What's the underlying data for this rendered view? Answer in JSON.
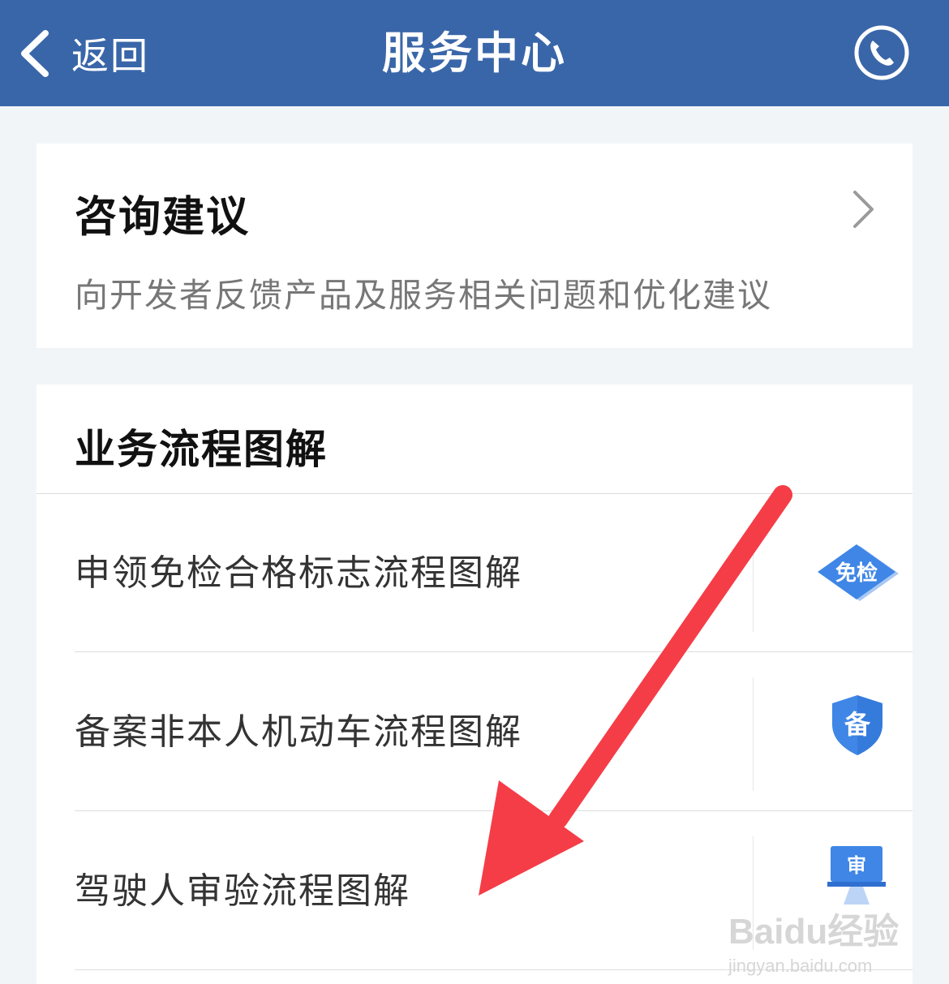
{
  "header": {
    "back_label": "返回",
    "title": "服务中心",
    "back_icon": "chevron-left-icon",
    "phone_icon": "phone-icon"
  },
  "consult": {
    "title": "咨询建议",
    "subtitle": "向开发者反馈产品及服务相关问题和优化建议",
    "chevron_icon": "chevron-right-icon"
  },
  "process": {
    "title": "业务流程图解",
    "items": [
      {
        "label": "申领免检合格标志流程图解",
        "icon_text": "免检",
        "icon": "exemption-diamond-icon"
      },
      {
        "label": "备案非本人机动车流程图解",
        "icon_text": "备",
        "icon": "record-shield-icon"
      },
      {
        "label": "驾驶人审验流程图解",
        "icon_text": "审",
        "icon": "review-monitor-icon"
      }
    ]
  },
  "watermark": {
    "brand": "Baidu经验",
    "url": "jingyan.baidu.com"
  },
  "colors": {
    "header_bg": "#3966a8",
    "page_bg": "#f2f5f8",
    "icon_blue": "#3f86e6",
    "annotation_arrow": "#f53d47"
  }
}
